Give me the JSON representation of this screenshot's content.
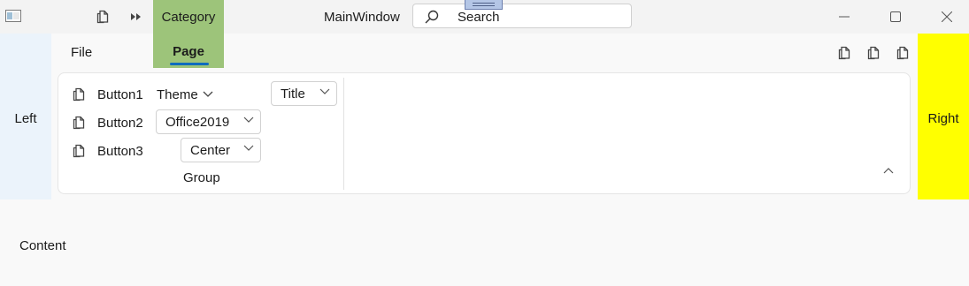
{
  "window": {
    "title": "MainWindow",
    "search_placeholder": "Search",
    "category_tab": "Category"
  },
  "tabs": {
    "file": "File",
    "page": "Page"
  },
  "panes": {
    "left": "Left",
    "right": "Right",
    "content": "Content"
  },
  "ribbon": {
    "buttons": [
      "Button1",
      "Button2",
      "Button3"
    ],
    "theme_menu": "Theme",
    "theme_value": "Office2019",
    "alignment_value": "Center",
    "title_value": "Title",
    "group_label": "Group"
  },
  "colors": {
    "category_tab": "#9dc47a",
    "left_pane": "#ebf3fb",
    "right_pane": "#ffff00",
    "accent": "#0f6cbd"
  },
  "icons": {
    "app": "app-icon",
    "quick_access_copy": "copy-icon",
    "quick_access_more": "double-chevron-right-icon",
    "search": "search-icon",
    "minimize": "minimize-icon",
    "maximize": "maximize-icon",
    "close": "close-icon",
    "ribbon_copy": "copy-icon",
    "collapse": "chevron-up-icon"
  }
}
